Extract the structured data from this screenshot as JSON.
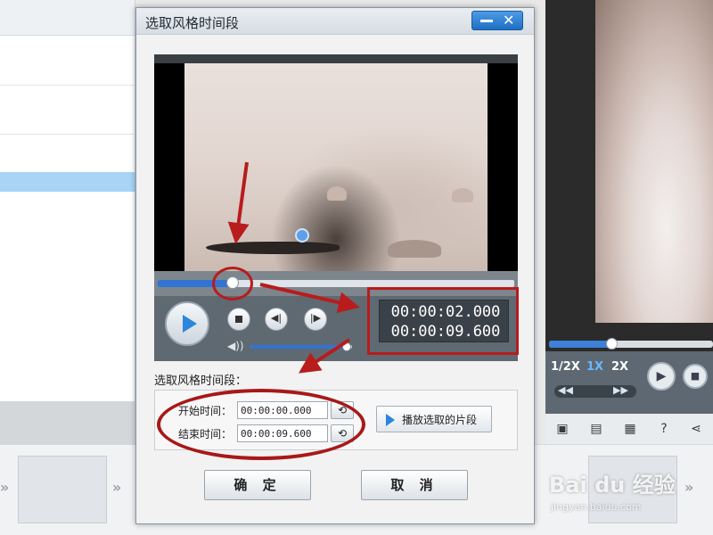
{
  "dialog": {
    "title": "选取风格时间段",
    "section_label": "选取风格时间段：",
    "start_label": "开始时间：",
    "start_value": "00:00:00.000",
    "end_label": "结束时间：",
    "end_value": "00:00:09.600",
    "play_selection_label": "播放选取的片段",
    "ok_label": "确 定",
    "cancel_label": "取 消"
  },
  "player": {
    "current_time": "00:00:02.000",
    "total_time": "00:00:09.600",
    "progress_fraction": 0.21,
    "volume_fraction": 0.95
  },
  "background_player": {
    "speed_half": "1/2X",
    "speed_1x": "1X",
    "speed_2x": "2X",
    "progress_fraction": 0.38
  },
  "watermark": {
    "main": "Bai du 经验",
    "sub": "jingyan.baidu.com"
  },
  "colors": {
    "accent": "#3174d4",
    "annotation": "#b81c1c",
    "titlebar_button": "#1f6fc3"
  }
}
